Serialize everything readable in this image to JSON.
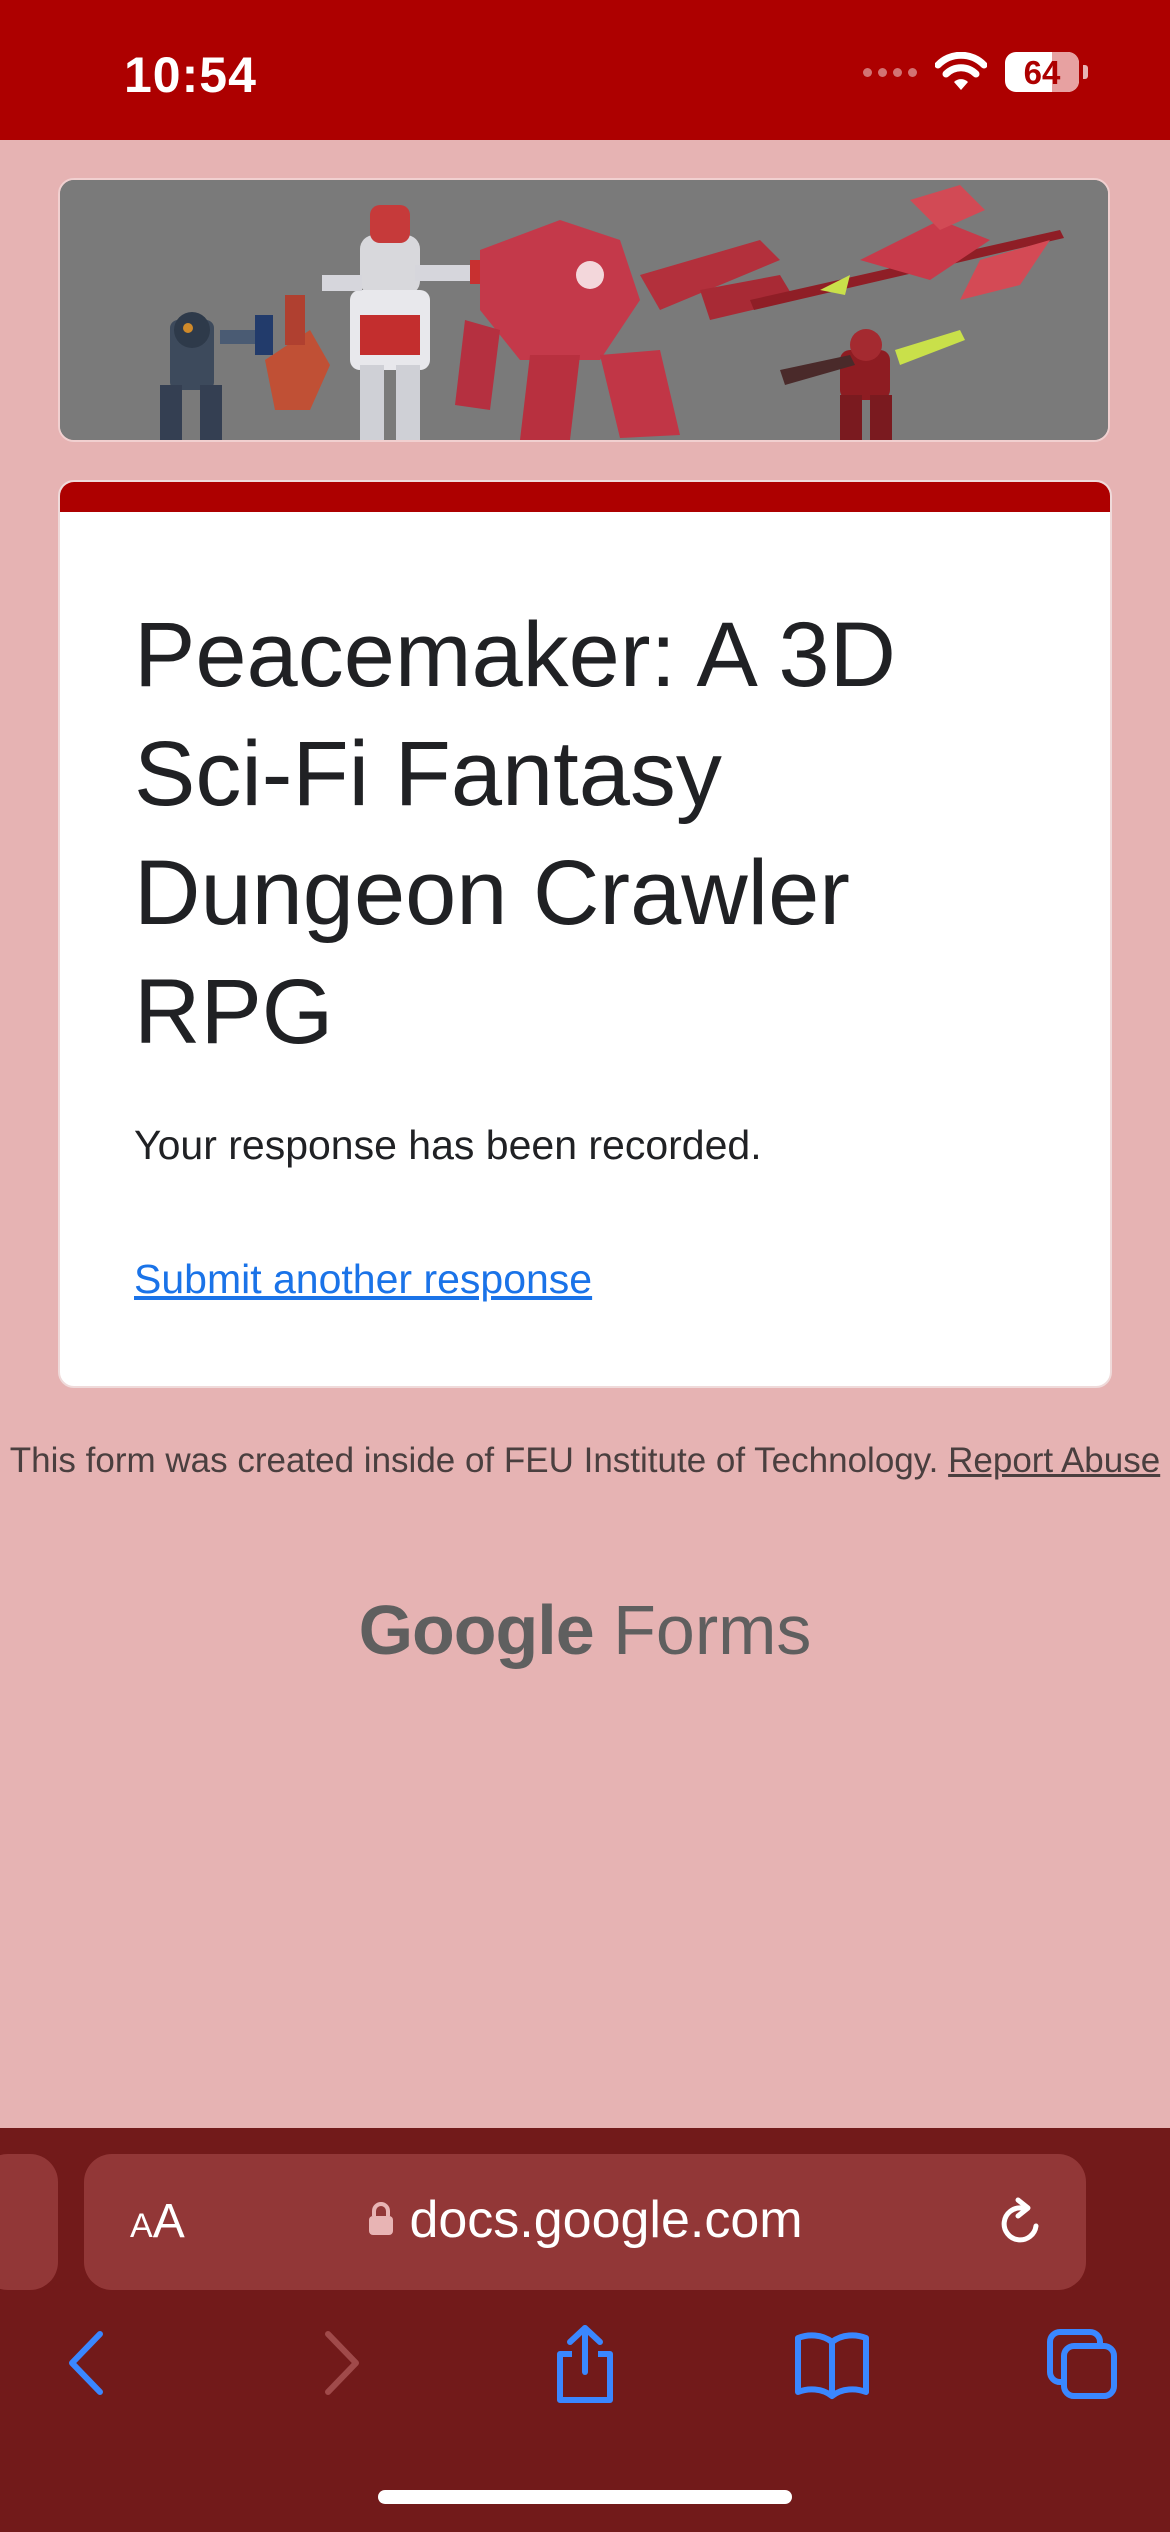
{
  "status_bar": {
    "time": "10:54",
    "battery": "64"
  },
  "form": {
    "title": "Peacemaker: A 3D Sci-Fi Fantasy Dungeon Crawler RPG",
    "confirmation": "Your response has been recorded.",
    "submit_another": "Submit another response"
  },
  "footer": {
    "created_text": "This form was created inside of FEU Institute of Technology.",
    "report_abuse": "Report Abuse",
    "logo_google": "Google",
    "logo_forms": "Forms"
  },
  "browser": {
    "text_size_label_small": "A",
    "text_size_label_large": "A",
    "url": "docs.google.com"
  },
  "colors": {
    "theme": "#ad0000",
    "page_background": "#e6b3b3",
    "link": "#1a73e8",
    "chrome": "#721a1a"
  },
  "icons": [
    "wifi-icon",
    "battery-icon",
    "lock-icon",
    "reload-icon",
    "back-icon",
    "forward-icon",
    "share-icon",
    "bookmarks-icon",
    "tabs-icon"
  ]
}
